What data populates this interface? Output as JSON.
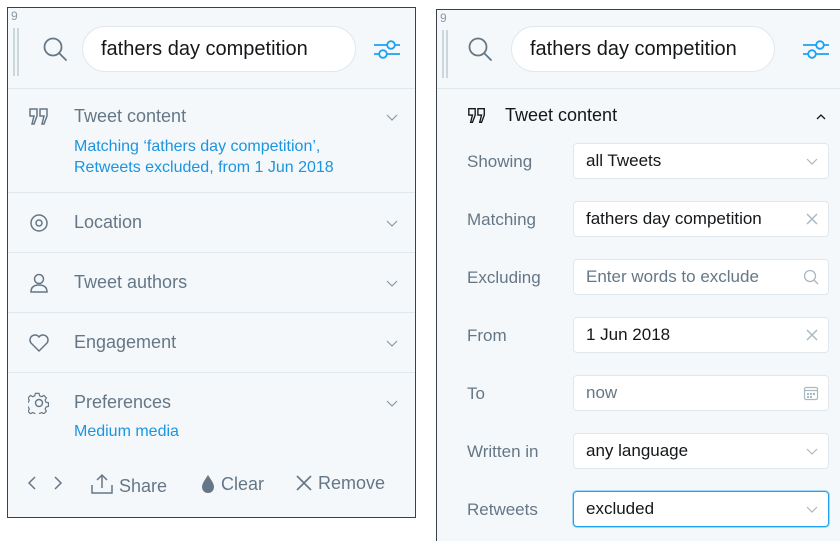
{
  "left": {
    "column_number": "9",
    "search_value": "fathers day competition",
    "sections": [
      {
        "title": "Tweet content",
        "subtitle": [
          "Matching ‘fathers day competition’,",
          "Retweets excluded, from 1 Jun 2018"
        ],
        "icon": "quote-icon"
      },
      {
        "title": "Location",
        "icon": "location-pin-icon"
      },
      {
        "title": "Tweet authors",
        "icon": "user-icon"
      },
      {
        "title": "Engagement",
        "icon": "heart-icon"
      },
      {
        "title": "Preferences",
        "subtitle": [
          "Medium media"
        ],
        "icon": "gear-icon"
      }
    ],
    "footer": {
      "share": "Share",
      "clear": "Clear",
      "remove": "Remove"
    }
  },
  "right": {
    "column_number": "9",
    "search_value": "fathers day competition",
    "section_title": "Tweet content",
    "rows": [
      {
        "label": "Showing",
        "value": "all Tweets",
        "control": "dropdown"
      },
      {
        "label": "Matching",
        "value": "fathers day competition",
        "control": "clearable"
      },
      {
        "label": "Excluding",
        "placeholder": "Enter words to exclude",
        "control": "search"
      },
      {
        "label": "From",
        "value": "1 Jun 2018",
        "control": "clearable"
      },
      {
        "label": "To",
        "value": "now",
        "control": "calendar"
      },
      {
        "label": "Written in",
        "value": "any language",
        "control": "dropdown"
      },
      {
        "label": "Retweets",
        "value": "excluded",
        "control": "dropdown"
      }
    ]
  },
  "colors": {
    "accent": "#1da1f2",
    "link": "#1b95e0",
    "muted": "#657786",
    "background": "#f5f8fa",
    "border": "#e1e8ed"
  }
}
